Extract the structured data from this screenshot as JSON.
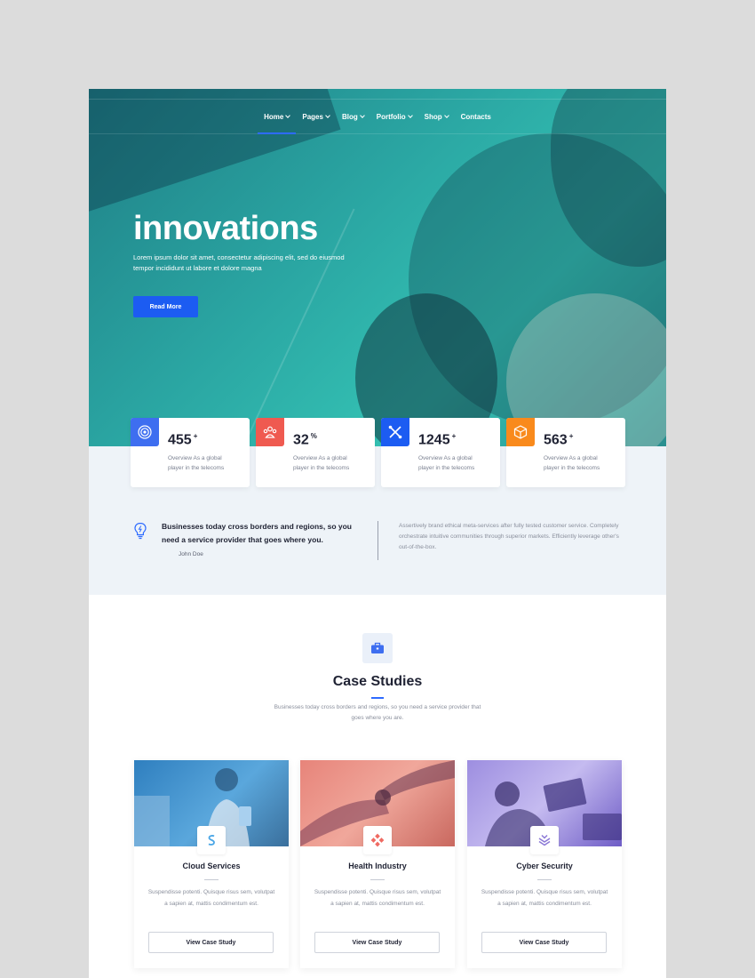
{
  "nav": {
    "items": [
      {
        "label": "Home",
        "has_dropdown": true,
        "active": true
      },
      {
        "label": "Pages",
        "has_dropdown": true
      },
      {
        "label": "Blog",
        "has_dropdown": true
      },
      {
        "label": "Portfolio",
        "has_dropdown": true
      },
      {
        "label": "Shop",
        "has_dropdown": true
      },
      {
        "label": "Contacts",
        "has_dropdown": false
      }
    ]
  },
  "hero": {
    "title": "innovations",
    "text": "Lorem ipsum dolor sit amet, consectetur adipiscing elit, sed do eiusmod tempor incididunt ut labore et dolore magna",
    "button_label": "Read More"
  },
  "stats": [
    {
      "value": "455",
      "suffix": "+",
      "text": "Overview As a global player in the telecoms",
      "icon": "target-icon",
      "color": "#3e6ef0"
    },
    {
      "value": "32",
      "suffix": "%",
      "text": "Overview As a global player in the telecoms",
      "icon": "team-icon",
      "color": "#ef5a50"
    },
    {
      "value": "1245",
      "suffix": "+",
      "text": "Overview As a global player in the telecoms",
      "icon": "tools-icon",
      "color": "#1c5cf2"
    },
    {
      "value": "563",
      "suffix": "+",
      "text": "Overview As a global player in the telecoms",
      "icon": "cube-icon",
      "color": "#f98a1c"
    }
  ],
  "quote": {
    "text": "Businesses today cross borders and regions, so you need a service provider that goes where you.",
    "author": "John Doe",
    "right_text": "Assertively brand ethical meta-services after fully tested customer service. Completely orchestrate intuitive communities through superior markets. Efficiently leverage other's out-of-the-box."
  },
  "case_studies": {
    "title": "Case Studies",
    "subtitle": "Businesses today cross borders and regions, so you need a service provider that goes where you are.",
    "cards": [
      {
        "title": "Cloud Services",
        "text": "Suspendisse potenti. Quisque risus sem, volutpat a sapien at, mattis condimentum est.",
        "button_label": "View Case Study",
        "icon": "cloud-s-icon",
        "tint": "#3f8fd2"
      },
      {
        "title": "Health Industry",
        "text": "Suspendisse potenti. Quisque risus sem, volutpat a sapien at, mattis condimentum est.",
        "button_label": "View Case Study",
        "icon": "health-icon",
        "tint": "#e9827a"
      },
      {
        "title": "Cyber Security",
        "text": "Suspendisse potenti. Quisque risus sem, volutpat a sapien at, mattis condimentum est.",
        "button_label": "View Case Study",
        "icon": "layers-icon",
        "tint": "#8b78d6"
      }
    ]
  },
  "colors": {
    "accent": "#1c5cf2",
    "hero_teal": "#2aa5a2",
    "stats_band": "#eef3f8"
  }
}
